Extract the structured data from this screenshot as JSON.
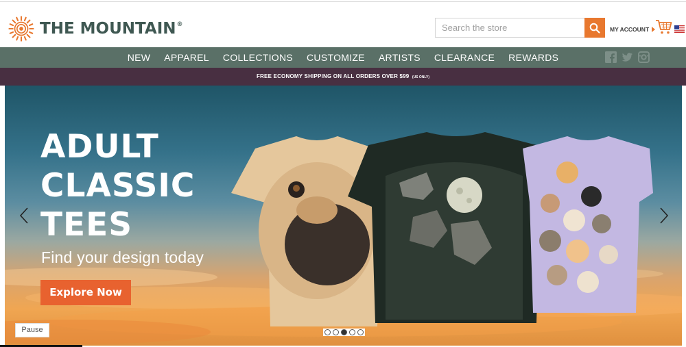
{
  "brand": {
    "name": "THE MOUNTAIN",
    "registered": "®",
    "color": "#3f5852",
    "accent": "#e8782f"
  },
  "search": {
    "placeholder": "Search the store",
    "button_icon": "search-icon"
  },
  "account": {
    "label": "MY ACCOUNT",
    "cart_icon": "shopping-cart-icon",
    "flag_icon": "us-flag-icon"
  },
  "nav": {
    "items": [
      {
        "label": "NEW"
      },
      {
        "label": "APPAREL"
      },
      {
        "label": "COLLECTIONS"
      },
      {
        "label": "CUSTOMIZE"
      },
      {
        "label": "ARTISTS"
      },
      {
        "label": "CLEARANCE"
      },
      {
        "label": "REWARDS"
      }
    ],
    "socials": [
      "facebook-icon",
      "twitter-icon",
      "instagram-icon"
    ],
    "background": "#5a7067"
  },
  "promo": {
    "text": "FREE ECONOMY SHIPPING ON ALL ORDERS OVER $99",
    "note": "(US ONLY)",
    "background": "#482f41"
  },
  "hero": {
    "title_line1": "ADULT",
    "title_line2": "CLASSIC",
    "title_line3": "TEES",
    "subtitle": "Find your design today",
    "cta_label": "Explore Now",
    "cta_color": "#e8622f",
    "pause_label": "Pause",
    "slides_count": 5,
    "active_slide": 3
  }
}
